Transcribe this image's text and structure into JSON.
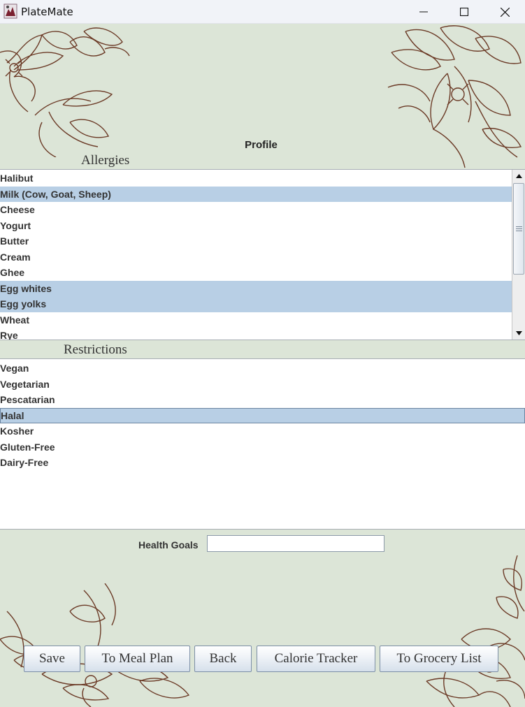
{
  "window": {
    "title": "PlateMate",
    "controls": {
      "minimize": "minimize-icon",
      "maximize": "maximize-icon",
      "close": "close-icon"
    }
  },
  "profile": {
    "heading": "Profile",
    "allergies": {
      "title": "Allergies",
      "items": [
        {
          "label": "Halibut",
          "selected": false
        },
        {
          "label": "Milk (Cow, Goat, Sheep)",
          "selected": true
        },
        {
          "label": "Cheese",
          "selected": false
        },
        {
          "label": "Yogurt",
          "selected": false
        },
        {
          "label": "Butter",
          "selected": false
        },
        {
          "label": "Cream",
          "selected": false
        },
        {
          "label": "Ghee",
          "selected": false
        },
        {
          "label": "Egg whites",
          "selected": true
        },
        {
          "label": "Egg yolks",
          "selected": true
        },
        {
          "label": "Wheat",
          "selected": false
        },
        {
          "label": "Rye",
          "selected": false
        }
      ]
    },
    "restrictions": {
      "title": "Restrictions",
      "items": [
        {
          "label": "Vegan",
          "selected": false
        },
        {
          "label": "Vegetarian",
          "selected": false
        },
        {
          "label": "Pescatarian",
          "selected": false
        },
        {
          "label": "Halal",
          "selected": true
        },
        {
          "label": "Kosher",
          "selected": false
        },
        {
          "label": "Gluten-Free",
          "selected": false
        },
        {
          "label": "Dairy-Free",
          "selected": false
        }
      ]
    },
    "health_goals": {
      "label": "Health Goals",
      "value": ""
    }
  },
  "buttons": {
    "save": "Save",
    "meal_plan": "To Meal Plan",
    "back": "Back",
    "calorie_tracker": "Calorie Tracker",
    "grocery_list": "To Grocery List"
  },
  "colors": {
    "background": "#dce5d7",
    "selection": "#b8cfe5",
    "floral_line": "#6b3a26",
    "list_background": "#ffffff"
  }
}
